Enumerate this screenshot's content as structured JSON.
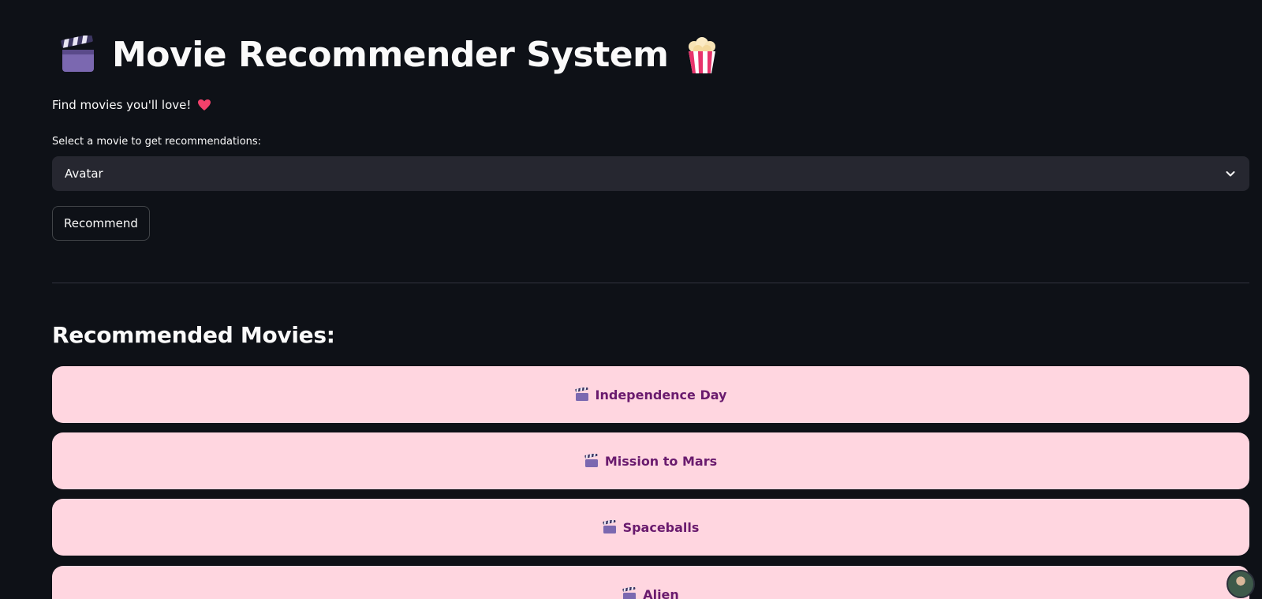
{
  "header": {
    "title": "Movie Recommender System",
    "title_left_icon": "clapperboard-icon",
    "title_right_icon": "popcorn-icon",
    "subtitle": "Find movies you'll love!",
    "subtitle_icon": "heart-icon"
  },
  "selector": {
    "label": "Select a movie to get recommendations:",
    "selected_value": "Avatar"
  },
  "actions": {
    "recommend_label": "Recommend"
  },
  "results": {
    "heading": "Recommended Movies:",
    "items": [
      {
        "title": "Independence Day",
        "icon": "clapperboard-icon"
      },
      {
        "title": "Mission to Mars",
        "icon": "clapperboard-icon"
      },
      {
        "title": "Spaceballs",
        "icon": "clapperboard-icon"
      },
      {
        "title": "Alien",
        "icon": "clapperboard-icon"
      }
    ]
  },
  "colors": {
    "background": "#0e1117",
    "card_background": "#ffd6e0",
    "card_text": "#6a1b6e",
    "select_background": "#262730"
  }
}
